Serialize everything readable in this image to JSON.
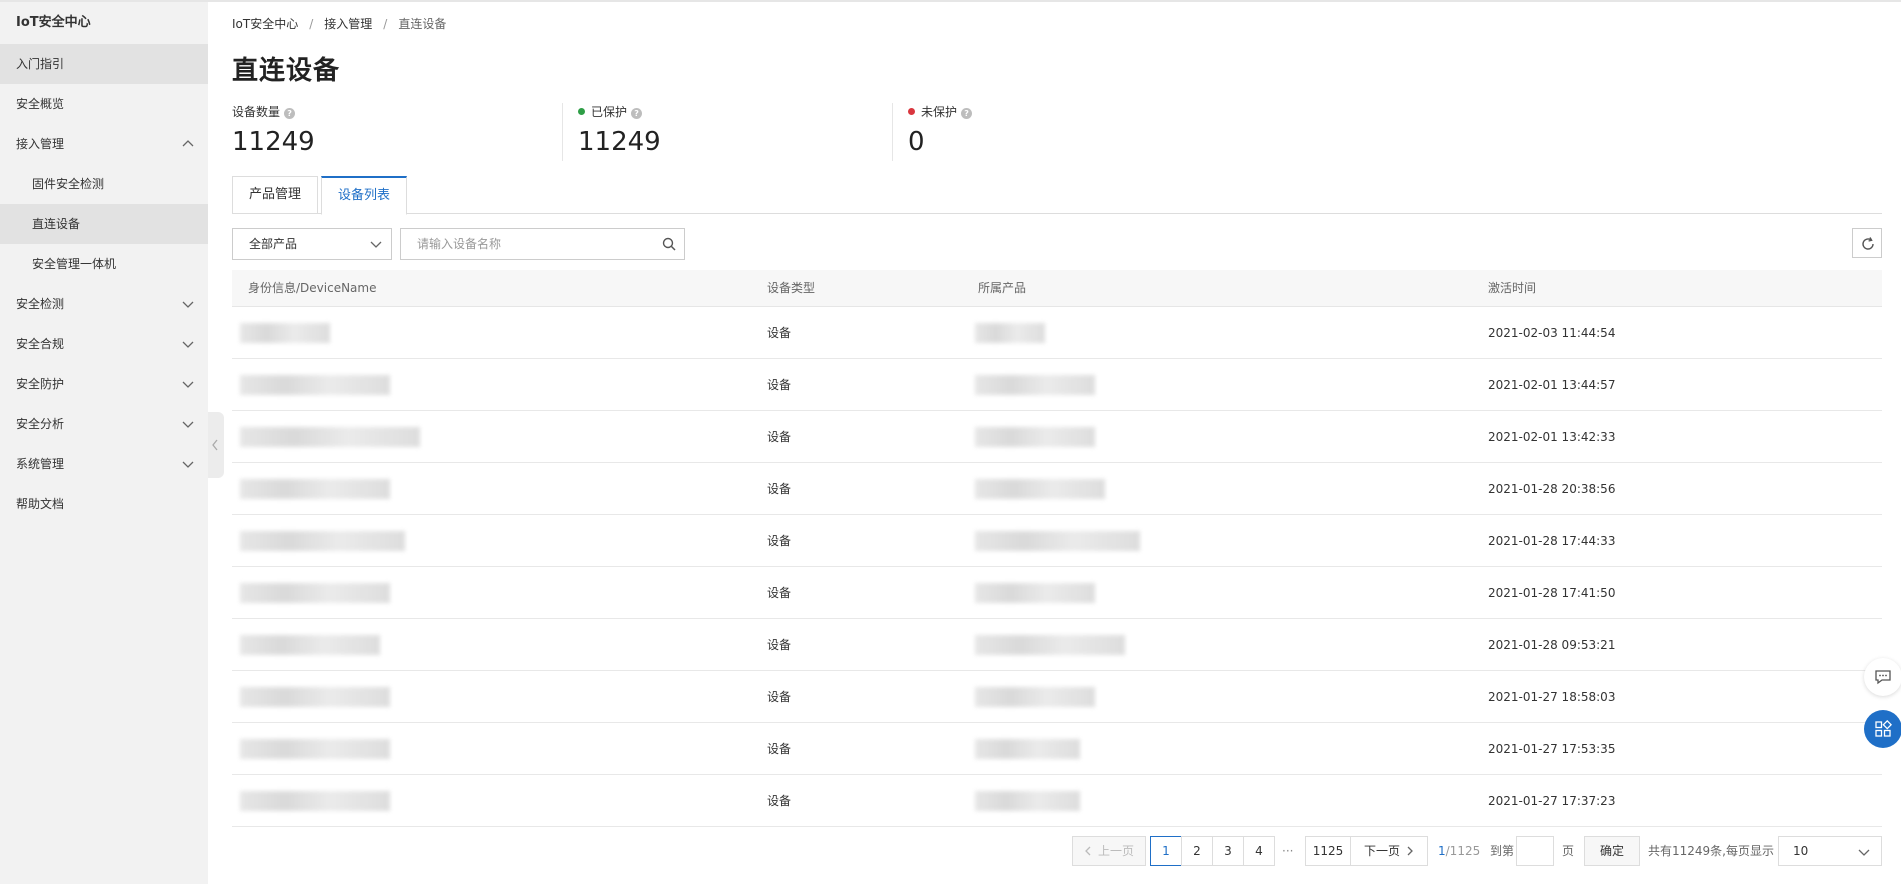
{
  "sidebar": {
    "title": "IoT安全中心",
    "items": [
      {
        "label": "入门指引",
        "active": true
      },
      {
        "label": "安全概览"
      },
      {
        "label": "接入管理",
        "expanded": true
      },
      {
        "label": "固件安全检测",
        "sub": true
      },
      {
        "label": "直连设备",
        "sub": true,
        "active": true
      },
      {
        "label": "安全管理一体机",
        "sub": true
      },
      {
        "label": "安全检测"
      },
      {
        "label": "安全合规"
      },
      {
        "label": "安全防护"
      },
      {
        "label": "安全分析"
      },
      {
        "label": "系统管理"
      },
      {
        "label": "帮助文档"
      }
    ]
  },
  "breadcrumb": {
    "items": [
      "IoT安全中心",
      "接入管理",
      "直连设备"
    ],
    "separator": "/"
  },
  "page": {
    "title": "直连设备"
  },
  "stats": [
    {
      "label": "设备数量",
      "value": "11249",
      "help": "?"
    },
    {
      "label": "已保护",
      "value": "11249",
      "help": "?",
      "dot_color": "#2e9e46"
    },
    {
      "label": "未保护",
      "value": "0",
      "help": "?",
      "dot_color": "#d9363e"
    }
  ],
  "tabs": [
    {
      "label": "产品管理",
      "active": false
    },
    {
      "label": "设备列表",
      "active": true
    }
  ],
  "filters": {
    "product_select": "全部产品",
    "search_placeholder": "请输入设备名称"
  },
  "table": {
    "headers": [
      "身份信息/DeviceName",
      "设备类型",
      "所属产品",
      "激活时间"
    ],
    "rows": [
      {
        "type": "设备",
        "time": "2021-02-03 11:44:54"
      },
      {
        "type": "设备",
        "time": "2021-02-01 13:44:57"
      },
      {
        "type": "设备",
        "time": "2021-02-01 13:42:33"
      },
      {
        "type": "设备",
        "time": "2021-01-28 20:38:56"
      },
      {
        "type": "设备",
        "time": "2021-01-28 17:44:33"
      },
      {
        "type": "设备",
        "time": "2021-01-28 17:41:50"
      },
      {
        "type": "设备",
        "time": "2021-01-28 09:53:21"
      },
      {
        "type": "设备",
        "time": "2021-01-27 18:58:03"
      },
      {
        "type": "设备",
        "time": "2021-01-27 17:53:35"
      },
      {
        "type": "设备",
        "time": "2021-01-27 17:37:23"
      }
    ]
  },
  "pagination": {
    "prev": "上一页",
    "pages": [
      "1",
      "2",
      "3",
      "4"
    ],
    "ellipsis": "···",
    "last": "1125",
    "next": "下一页",
    "current_page": "1",
    "total_pages": "/1125",
    "goto_prefix": "到第",
    "goto_suffix": "页",
    "confirm": "确定",
    "summary": "共有11249条,每页显示",
    "page_size": "10"
  },
  "colors": {
    "accent": "#1f6fc7",
    "protected": "#2e9e46",
    "unprotected": "#d9363e"
  },
  "floating": {
    "chat_icon": "chat-icon",
    "apps_icon": "grid-apps-icon"
  }
}
